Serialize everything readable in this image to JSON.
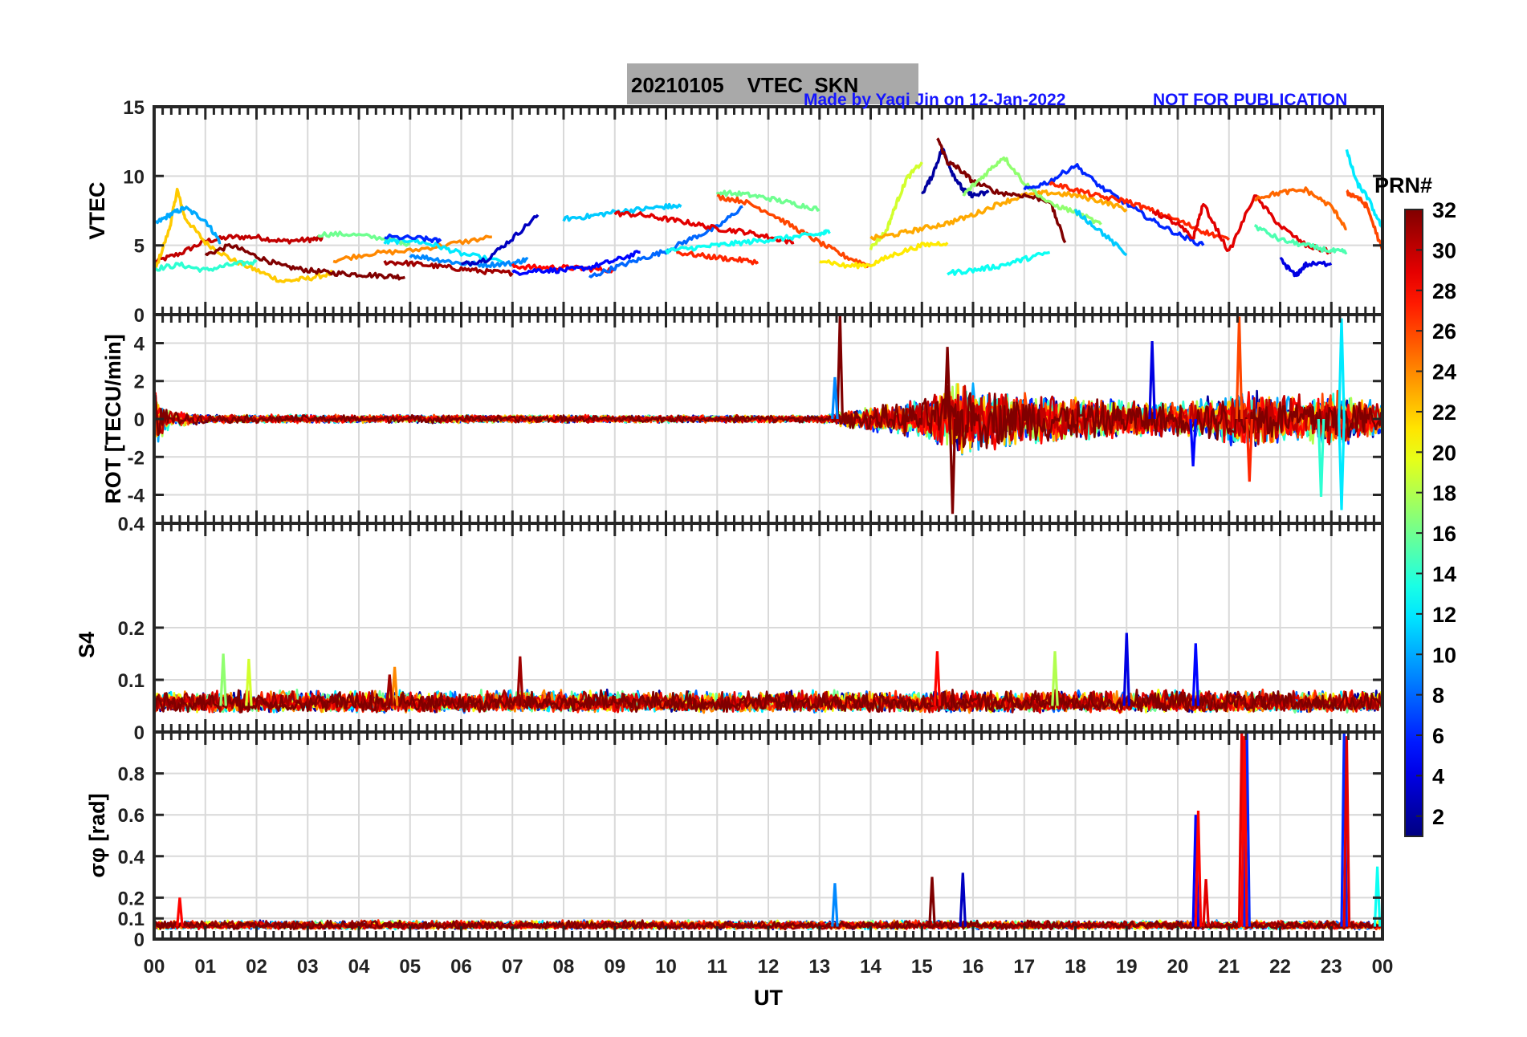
{
  "figure": {
    "title": "20210105    VTEC  SKN",
    "credit": "Made by Yaqi Jin on 12-Jan-2022",
    "notice": "NOT FOR PUBLICATION",
    "credit_color": "#1414ff",
    "title_box_color": "#a9a9a9",
    "colorbar_label": "PRN#",
    "colorbar_ticks": [
      "2",
      "4",
      "6",
      "8",
      "10",
      "12",
      "14",
      "16",
      "18",
      "20",
      "22",
      "24",
      "26",
      "28",
      "30",
      "32"
    ],
    "colorbar_range": [
      1,
      32
    ],
    "colormap": "jet",
    "xlabel": "UT"
  },
  "chart_data": [
    {
      "type": "line",
      "panel": "vtec",
      "ylabel": "VTEC",
      "ylim": [
        0,
        15
      ],
      "yticks": [
        "15",
        "10",
        "5",
        "0"
      ],
      "ytick_values": [
        15,
        10,
        5,
        0
      ],
      "xlim": [
        0,
        24
      ],
      "xticks": [
        "00",
        "01",
        "02",
        "03",
        "04",
        "05",
        "06",
        "07",
        "08",
        "09",
        "10",
        "11",
        "12",
        "13",
        "14",
        "15",
        "16",
        "17",
        "18",
        "19",
        "20",
        "21",
        "22",
        "23",
        "00"
      ],
      "grid": true,
      "series": [
        {
          "prn": 30,
          "x": [
            0.0,
            0.5,
            1.0,
            1.5,
            2.0,
            2.5,
            3.0,
            3.3
          ],
          "y": [
            3.8,
            4.4,
            5.3,
            5.6,
            5.6,
            5.3,
            5.4,
            5.5
          ]
        },
        {
          "prn": 22,
          "x": [
            0.0,
            0.3,
            0.45,
            0.6,
            1.0,
            1.5,
            2.0,
            2.5,
            3.0,
            3.5
          ],
          "y": [
            3.0,
            6.2,
            9.0,
            7.0,
            5.2,
            4.0,
            3.2,
            2.4,
            2.6,
            3.0
          ]
        },
        {
          "prn": 10,
          "x": [
            0.0,
            0.3,
            0.6,
            1.0,
            1.3
          ],
          "y": [
            6.5,
            7.2,
            7.7,
            6.8,
            5.2
          ]
        },
        {
          "prn": 32,
          "x": [
            1.0,
            1.5,
            2.0,
            2.5,
            3.0,
            3.5,
            4.0,
            4.5,
            4.9
          ],
          "y": [
            4.3,
            5.0,
            4.2,
            3.5,
            3.2,
            3.0,
            2.9,
            2.8,
            2.7
          ]
        },
        {
          "prn": 14,
          "x": [
            0.0,
            0.5,
            1.0,
            1.5,
            2.0
          ],
          "y": [
            3.3,
            3.6,
            3.2,
            3.6,
            3.8
          ]
        },
        {
          "prn": 16,
          "x": [
            3.2,
            3.8,
            4.5,
            5.0
          ],
          "y": [
            5.8,
            5.8,
            5.5,
            5.1
          ]
        },
        {
          "prn": 24,
          "x": [
            3.5,
            4.2,
            5.0,
            5.8,
            6.6
          ],
          "y": [
            3.9,
            4.4,
            4.6,
            5.1,
            5.6
          ]
        },
        {
          "prn": 12,
          "x": [
            4.5,
            5.0,
            5.5,
            6.0,
            6.8
          ],
          "y": [
            5.2,
            5.4,
            5.0,
            4.4,
            3.8
          ]
        },
        {
          "prn": 6,
          "x": [
            4.5,
            5.2,
            5.6
          ],
          "y": [
            5.6,
            5.5,
            5.3
          ]
        },
        {
          "prn": 31,
          "x": [
            4.5,
            5.0,
            5.5,
            6.0,
            6.5,
            7.0
          ],
          "y": [
            3.8,
            3.7,
            3.5,
            3.3,
            3.1,
            3.0
          ]
        },
        {
          "prn": 9,
          "x": [
            5.0,
            5.5,
            6.0,
            6.5,
            7.0,
            7.3
          ],
          "y": [
            4.3,
            4.0,
            3.7,
            3.6,
            3.7,
            4.0
          ]
        },
        {
          "prn": 3,
          "x": [
            6.0,
            6.5,
            7.0,
            7.5
          ],
          "y": [
            3.6,
            4.0,
            5.5,
            7.2
          ]
        },
        {
          "prn": 28,
          "x": [
            7.0,
            7.5,
            8.0,
            8.5,
            9.0
          ],
          "y": [
            3.5,
            3.4,
            3.4,
            3.3,
            3.2
          ]
        },
        {
          "prn": 5,
          "x": [
            7.0,
            7.5,
            8.0,
            8.5,
            9.0,
            9.5
          ],
          "y": [
            3.0,
            3.2,
            3.2,
            3.4,
            3.9,
            4.5
          ]
        },
        {
          "prn": 11,
          "x": [
            8.0,
            8.5,
            9.0,
            9.5,
            10.0,
            10.3
          ],
          "y": [
            6.9,
            7.1,
            7.4,
            7.6,
            7.8,
            7.8
          ]
        },
        {
          "prn": 8,
          "x": [
            8.5,
            9.0,
            9.5,
            10.0,
            10.5,
            11.0,
            11.5
          ],
          "y": [
            2.7,
            3.4,
            4.0,
            4.6,
            5.5,
            6.3,
            7.8
          ]
        },
        {
          "prn": 29,
          "x": [
            9.0,
            9.5,
            10.0,
            10.5,
            11.0,
            11.5,
            12.0,
            12.5
          ],
          "y": [
            7.3,
            7.2,
            6.9,
            6.6,
            6.2,
            6.0,
            5.6,
            5.2
          ]
        },
        {
          "prn": 16,
          "x": [
            11.0,
            11.5,
            12.0,
            12.5,
            13.0
          ],
          "y": [
            8.8,
            8.7,
            8.4,
            8.0,
            7.6
          ]
        },
        {
          "prn": 26,
          "x": [
            11.0,
            11.5,
            12.0,
            12.5,
            13.0,
            13.5,
            14.0
          ],
          "y": [
            8.5,
            8.2,
            7.4,
            6.3,
            5.2,
            4.2,
            3.5
          ]
        },
        {
          "prn": 27,
          "x": [
            10.2,
            10.8,
            11.3,
            11.8
          ],
          "y": [
            4.5,
            4.2,
            4.0,
            3.8
          ]
        },
        {
          "prn": 13,
          "x": [
            10.0,
            10.5,
            11.0,
            11.5,
            12.0,
            12.5,
            13.0,
            13.2
          ],
          "y": [
            4.6,
            4.8,
            5.0,
            5.2,
            5.4,
            5.6,
            5.8,
            6.0
          ]
        },
        {
          "prn": 21,
          "x": [
            13.0,
            13.5,
            14.0,
            14.5,
            15.0,
            15.5
          ],
          "y": [
            4.0,
            3.5,
            3.6,
            4.4,
            5.0,
            5.2
          ]
        },
        {
          "prn": 19,
          "x": [
            14.0,
            14.3,
            14.5,
            14.7,
            15.0
          ],
          "y": [
            4.8,
            6.0,
            8.0,
            9.8,
            11.0
          ]
        },
        {
          "prn": 23,
          "x": [
            14.0,
            14.5,
            15.0,
            15.5,
            16.0,
            16.5,
            17.0,
            17.5,
            18.0,
            18.5,
            19.0
          ],
          "y": [
            5.5,
            5.8,
            6.2,
            6.6,
            7.2,
            8.0,
            8.6,
            8.8,
            8.6,
            8.2,
            7.6
          ]
        },
        {
          "prn": 2,
          "x": [
            15.0,
            15.2,
            15.4,
            15.6,
            15.8,
            16.0,
            16.3
          ],
          "y": [
            8.7,
            10.0,
            12.0,
            10.2,
            9.0,
            8.6,
            8.8
          ]
        },
        {
          "prn": 32,
          "x": [
            15.3,
            15.5,
            15.7,
            16.0,
            16.5,
            17.0,
            17.5,
            17.8
          ],
          "y": [
            12.8,
            11.0,
            10.6,
            9.6,
            8.8,
            8.6,
            8.2,
            5.2
          ]
        },
        {
          "prn": 13,
          "x": [
            15.5,
            16.0,
            16.5,
            17.0,
            17.5
          ],
          "y": [
            3.0,
            3.2,
            3.5,
            4.0,
            4.5
          ]
        },
        {
          "prn": 17,
          "x": [
            15.8,
            16.2,
            16.6,
            17.0,
            17.5,
            18.0,
            18.5
          ],
          "y": [
            8.6,
            10.0,
            11.4,
            9.5,
            8.0,
            7.4,
            6.5
          ]
        },
        {
          "prn": 6,
          "x": [
            17.0,
            17.5,
            18.0,
            18.5,
            19.0,
            19.5,
            20.0,
            20.5
          ],
          "y": [
            9.0,
            9.6,
            10.8,
            9.2,
            8.0,
            6.8,
            5.8,
            5.0
          ]
        },
        {
          "prn": 27,
          "x": [
            17.5,
            18.0,
            18.5,
            19.0,
            19.5,
            20.0,
            20.5,
            21.0
          ],
          "y": [
            9.5,
            9.0,
            8.5,
            8.2,
            7.5,
            6.8,
            6.0,
            5.4
          ]
        },
        {
          "prn": 11,
          "x": [
            18.0,
            18.5,
            19.0
          ],
          "y": [
            7.5,
            6.0,
            4.3
          ]
        },
        {
          "prn": 29,
          "x": [
            19.5,
            20.0,
            20.3,
            20.5,
            21.0,
            21.5,
            22.0,
            22.5,
            23.0
          ],
          "y": [
            7.5,
            6.5,
            5.5,
            8.0,
            4.5,
            8.6,
            6.4,
            5.0,
            4.5
          ]
        },
        {
          "prn": 15,
          "x": [
            21.5,
            22.0,
            22.5,
            23.0,
            23.3
          ],
          "y": [
            6.4,
            5.4,
            5.0,
            4.6,
            4.5
          ]
        },
        {
          "prn": 4,
          "x": [
            22.0,
            22.3,
            22.5,
            23.0
          ],
          "y": [
            4.0,
            2.8,
            3.6,
            3.7
          ]
        },
        {
          "prn": 25,
          "x": [
            21.5,
            22.0,
            22.5,
            23.0,
            23.3
          ],
          "y": [
            8.4,
            8.8,
            9.0,
            7.8,
            6.2
          ]
        },
        {
          "prn": 12,
          "x": [
            23.3,
            23.5,
            23.7,
            24.0
          ],
          "y": [
            11.8,
            9.5,
            8.5,
            6.2
          ]
        },
        {
          "prn": 26,
          "x": [
            23.3,
            23.5,
            23.7,
            24.0
          ],
          "y": [
            8.8,
            8.5,
            7.8,
            4.6
          ]
        }
      ]
    },
    {
      "type": "line",
      "panel": "rot",
      "ylabel": "ROT [TECU/min]",
      "ylim": [
        -5.5,
        5.5
      ],
      "yticks": [
        "4",
        "2",
        "0",
        "-2",
        "-4"
      ],
      "ytick_values": [
        4,
        2,
        0,
        -2,
        -4
      ],
      "xlim": [
        0,
        24
      ],
      "grid": true,
      "noise_envelope": {
        "x": [
          0,
          0.3,
          1,
          13,
          14,
          15,
          15.6,
          17,
          19,
          20,
          21,
          21.4,
          22,
          23.2,
          23.5,
          24
        ],
        "amplitude": [
          2.2,
          0.6,
          0.3,
          0.25,
          0.9,
          1.4,
          2.6,
          1.8,
          1.3,
          1.2,
          1.8,
          2.2,
          1.6,
          1.9,
          1.6,
          1.2
        ]
      },
      "spikes": [
        {
          "x": 13.4,
          "y": 5.5,
          "prn": 32
        },
        {
          "x": 13.3,
          "y": 2.2,
          "prn": 9
        },
        {
          "x": 15.6,
          "y": -5.0,
          "prn": 32
        },
        {
          "x": 15.5,
          "y": 3.8,
          "prn": 32
        },
        {
          "x": 19.5,
          "y": 4.1,
          "prn": 4
        },
        {
          "x": 20.3,
          "y": -2.5,
          "prn": 5
        },
        {
          "x": 21.2,
          "y": 5.4,
          "prn": 26
        },
        {
          "x": 21.4,
          "y": -3.3,
          "prn": 27
        },
        {
          "x": 23.2,
          "y": 5.3,
          "prn": 12
        },
        {
          "x": 23.2,
          "y": -4.8,
          "prn": 12
        },
        {
          "x": 22.8,
          "y": -4.1,
          "prn": 14
        }
      ]
    },
    {
      "type": "line",
      "panel": "s4",
      "ylabel": "S4",
      "ylim": [
        0,
        0.4
      ],
      "yticks": [
        "0.4",
        "0.2",
        "0.1",
        "0"
      ],
      "ytick_values": [
        0.4,
        0.2,
        0.1,
        0
      ],
      "xlim": [
        0,
        24
      ],
      "grid": true,
      "baseline": 0.05,
      "noise_amplitude": 0.03,
      "spikes": [
        {
          "x": 1.35,
          "y": 0.15,
          "prn": 17
        },
        {
          "x": 1.85,
          "y": 0.14,
          "prn": 19
        },
        {
          "x": 4.7,
          "y": 0.125,
          "prn": 24
        },
        {
          "x": 7.15,
          "y": 0.145,
          "prn": 31
        },
        {
          "x": 15.3,
          "y": 0.155,
          "prn": 28
        },
        {
          "x": 17.6,
          "y": 0.155,
          "prn": 18
        },
        {
          "x": 19.0,
          "y": 0.19,
          "prn": 4
        },
        {
          "x": 20.35,
          "y": 0.17,
          "prn": 5
        },
        {
          "x": 4.6,
          "y": 0.11,
          "prn": 31
        }
      ]
    },
    {
      "type": "line",
      "panel": "sigma_phi",
      "ylabel": "σφ [rad]",
      "ylim": [
        0,
        1.0
      ],
      "yticks": [
        "0.8",
        "0.6",
        "0.4",
        "0.2",
        "0.1",
        "0"
      ],
      "ytick_values": [
        0.8,
        0.6,
        0.4,
        0.2,
        0.1,
        0
      ],
      "xlim": [
        0,
        24
      ],
      "grid": true,
      "baseline": 0.06,
      "noise_amplitude": 0.03,
      "spikes": [
        {
          "x": 0.5,
          "y": 0.2,
          "prn": 28
        },
        {
          "x": 13.3,
          "y": 0.27,
          "prn": 9
        },
        {
          "x": 15.2,
          "y": 0.3,
          "prn": 32
        },
        {
          "x": 15.8,
          "y": 0.32,
          "prn": 3
        },
        {
          "x": 20.35,
          "y": 0.6,
          "prn": 5
        },
        {
          "x": 20.4,
          "y": 0.62,
          "prn": 28
        },
        {
          "x": 20.55,
          "y": 0.29,
          "prn": 29
        },
        {
          "x": 21.25,
          "y": 1.0,
          "prn": 29
        },
        {
          "x": 21.35,
          "y": 1.0,
          "prn": 6
        },
        {
          "x": 21.3,
          "y": 0.98,
          "prn": 28
        },
        {
          "x": 23.25,
          "y": 1.0,
          "prn": 6
        },
        {
          "x": 23.3,
          "y": 0.98,
          "prn": 29
        },
        {
          "x": 23.9,
          "y": 0.35,
          "prn": 13
        }
      ]
    }
  ]
}
